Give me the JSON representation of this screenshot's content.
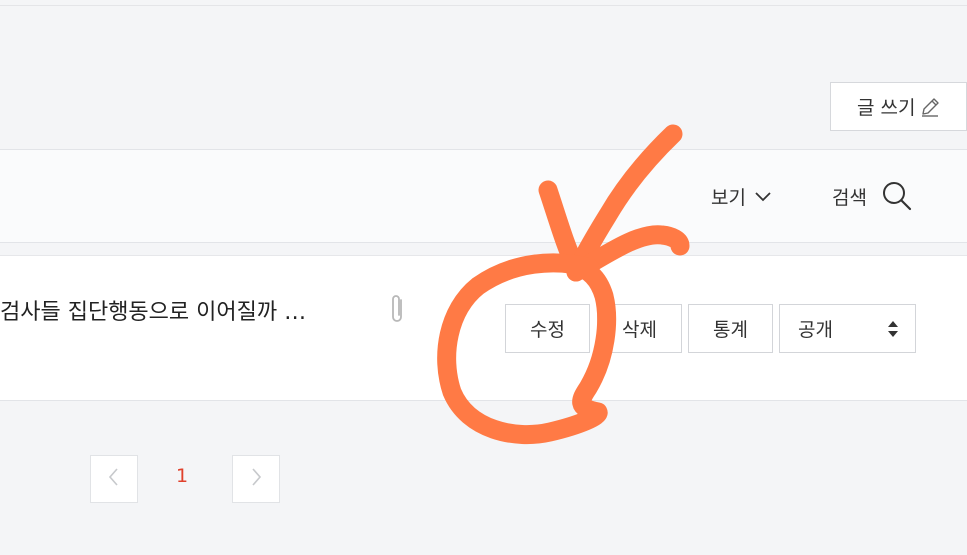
{
  "header": {
    "write_label": "글 쓰기"
  },
  "toolbar": {
    "view_label": "보기",
    "search_label": "검색"
  },
  "post": {
    "title": "검사들 집단행동으로 이어질까 …",
    "actions": {
      "edit": "수정",
      "delete": "삭제",
      "stats": "통계"
    },
    "visibility": "공개"
  },
  "pagination": {
    "current_page": "1"
  },
  "colors": {
    "accent": "#e0412c",
    "annotation": "#ff7a45"
  },
  "icons": [
    "pencil-icon",
    "chevron-down-icon",
    "search-icon",
    "paperclip-icon",
    "up-down-arrows-icon",
    "chevron-left-icon",
    "chevron-right-icon"
  ]
}
